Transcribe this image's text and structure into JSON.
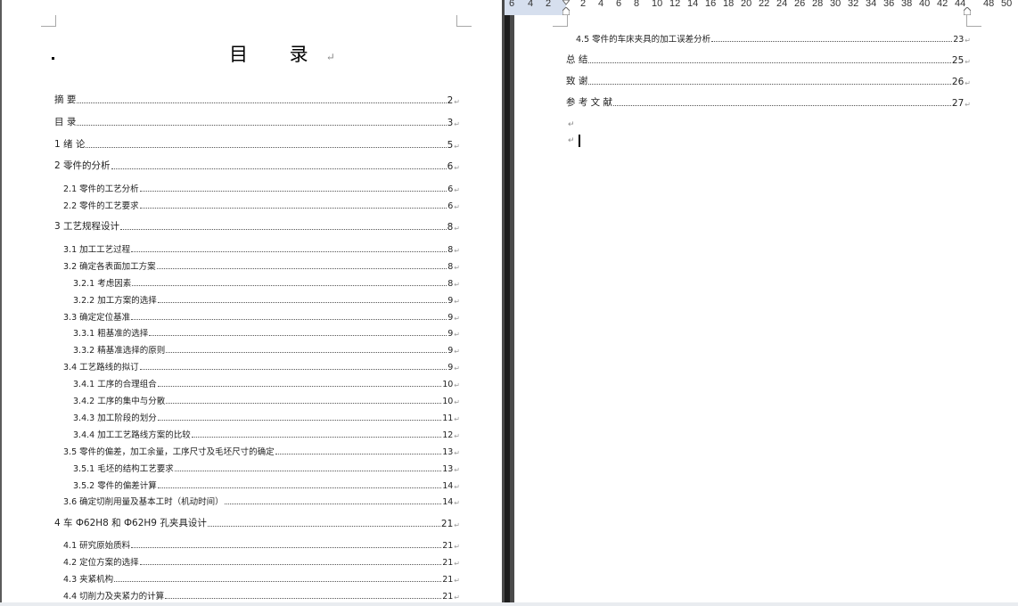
{
  "ruler": {
    "ticks": [
      "6",
      "4",
      "2",
      "2",
      "4",
      "6",
      "8",
      "10",
      "12",
      "14",
      "16",
      "18",
      "20",
      "22",
      "24",
      "26",
      "28",
      "30",
      "32",
      "34",
      "36",
      "38",
      "40",
      "42",
      "44",
      "48",
      "50"
    ]
  },
  "left_page": {
    "title": "目  录",
    "title_mark": "↵",
    "entries": [
      {
        "label": "摘    要",
        "page": "2",
        "level": 0
      },
      {
        "label": "目    录",
        "page": "3",
        "level": 0
      },
      {
        "label": "1  绪  论",
        "page": "5",
        "level": 0
      },
      {
        "label": "2  零件的分析 ",
        "page": "6",
        "level": 0
      },
      {
        "label": "2.1 零件的工艺分析",
        "page": "6",
        "level": 1
      },
      {
        "label": "2.2 零件的工艺要求",
        "page": "6",
        "level": 1
      },
      {
        "label": "3  工艺规程设计",
        "page": "8",
        "level": 0
      },
      {
        "label": "3.1  加工工艺过程",
        "page": "8",
        "level": 1
      },
      {
        "label": "3.2 确定各表面加工方案",
        "page": "8",
        "level": 1
      },
      {
        "label": "3.2.1  考虑因素",
        "page": "8",
        "level": 2
      },
      {
        "label": "3.2.2  加工方案的选择",
        "page": "9",
        "level": 2
      },
      {
        "label": "3.3 确定定位基准",
        "page": "9",
        "level": 1
      },
      {
        "label": "3.3.1 粗基准的选择",
        "page": "9",
        "level": 2
      },
      {
        "label": "3.3.2 精基准选择的原则",
        "page": "9",
        "level": 2
      },
      {
        "label": "3.4 工艺路线的拟订",
        "page": "9",
        "level": 1
      },
      {
        "label": "3.4.1 工序的合理组合",
        "page": "10",
        "level": 2
      },
      {
        "label": "3.4.2 工序的集中与分散",
        "page": "10",
        "level": 2
      },
      {
        "label": "3.4.3 加工阶段的划分",
        "page": "11",
        "level": 2
      },
      {
        "label": "3.4.4 加工工艺路线方案的比较",
        "page": "12",
        "level": 2
      },
      {
        "label": "3.5 零件的偏差，加工余量，工序尺寸及毛坯尺寸的确定",
        "page": "13",
        "level": 1
      },
      {
        "label": "3.5.1 毛坯的结构工艺要求",
        "page": "13",
        "level": 2
      },
      {
        "label": "3.5.2 零件的偏差计算",
        "page": "14",
        "level": 2
      },
      {
        "label": "3.6 确定切削用量及基本工时（机动时间）",
        "page": "14",
        "level": 1
      },
      {
        "label": "4  车 Ф62H8 和 Ф62H9 孔夹具设计",
        "page": "21",
        "level": 0
      },
      {
        "label": "4.1 研究原始质料",
        "page": "21",
        "level": 1
      },
      {
        "label": "4.2 定位方案的选择",
        "page": "21",
        "level": 1
      },
      {
        "label": "4.3 夹紧机构",
        "page": "21",
        "level": 1
      },
      {
        "label": "4.4 切削力及夹紧力的计算",
        "page": "21",
        "level": 1
      }
    ]
  },
  "right_page": {
    "entries": [
      {
        "label": "4.5 零件的车床夹具的加工误差分析",
        "page": "23",
        "level": 1
      },
      {
        "label": "总  结",
        "page": "25",
        "level": 0
      },
      {
        "label": "致    谢",
        "page": "26",
        "level": 0
      },
      {
        "label": "参 考 文 献",
        "page": "27",
        "level": 0
      }
    ],
    "paragraph_marks": [
      "↵",
      "↵"
    ]
  },
  "paragraph_mark": "↵"
}
